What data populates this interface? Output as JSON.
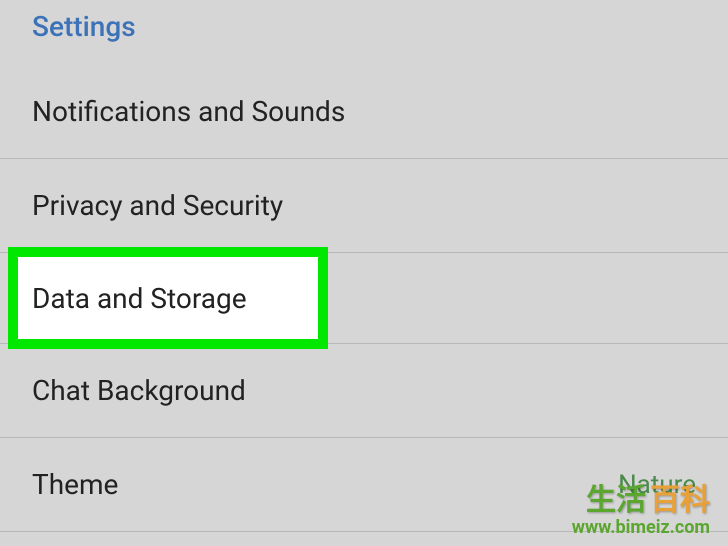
{
  "header": {
    "title": "Settings"
  },
  "items": {
    "notifications": "Notifications and Sounds",
    "privacy": "Privacy and Security",
    "dataStorage": "Data and Storage",
    "chatBackground": "Chat Background",
    "theme": "Theme",
    "themeValue": "Nature"
  },
  "watermark": {
    "cn1": "生活",
    "cn2": "百科",
    "url": "www.bimeiz.com"
  }
}
